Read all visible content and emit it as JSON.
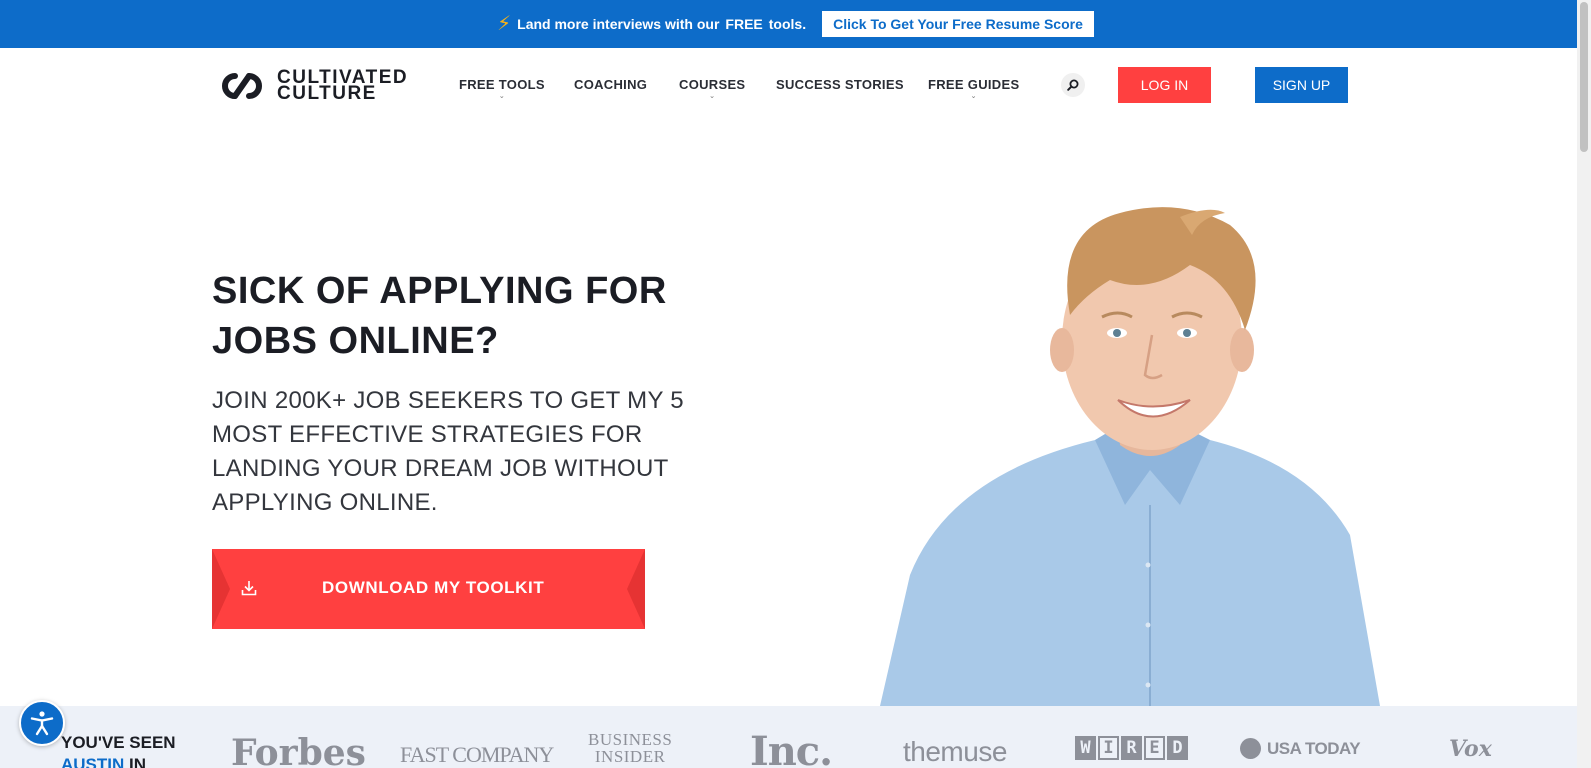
{
  "promo": {
    "text_before": "Land more interviews with our",
    "text_bold": "FREE",
    "text_after": "tools.",
    "button_label": "Click To Get Your Free Resume Score"
  },
  "nav": {
    "logo_line1": "CULTIVATED",
    "logo_line2": "CULTURE",
    "items": [
      {
        "label": "FREE TOOLS",
        "has_dropdown": true
      },
      {
        "label": "COACHING",
        "has_dropdown": false
      },
      {
        "label": "COURSES",
        "has_dropdown": true
      },
      {
        "label": "SUCCESS STORIES",
        "has_dropdown": false
      },
      {
        "label": "FREE GUIDES",
        "has_dropdown": true
      }
    ],
    "login_label": "LOG IN",
    "signup_label": "SIGN UP"
  },
  "hero": {
    "title": "SICK OF APPLYING FOR JOBS ONLINE?",
    "subtitle": "JOIN 200K+ JOB SEEKERS TO GET MY 5 MOST EFFECTIVE STRATEGIES FOR LANDING YOUR DREAM JOB WITHOUT APPLYING ONLINE.",
    "cta_label": "DOWNLOAD MY TOOLKIT"
  },
  "press": {
    "heading_line1": "YOU'VE SEEN",
    "heading_name": "AUSTIN",
    "heading_after": "IN",
    "logos": {
      "forbes": "Forbes",
      "fastcompany": "FAST COMPANY",
      "bi_line1": "BUSINESS",
      "bi_line2": "INSIDER",
      "inc": "Inc.",
      "themuse": "themuse",
      "wired": [
        "W",
        "I",
        "R",
        "E",
        "D"
      ],
      "usatoday": "USA TODAY",
      "vox": "Vox"
    }
  },
  "colors": {
    "brand_blue": "#0d6cc9",
    "brand_red": "#ff4040",
    "strip_bg": "#edf1f8"
  },
  "icons": [
    "lightning-bolt-icon",
    "search-icon",
    "download-icon",
    "accessibility-icon",
    "chevron-down-icon"
  ]
}
